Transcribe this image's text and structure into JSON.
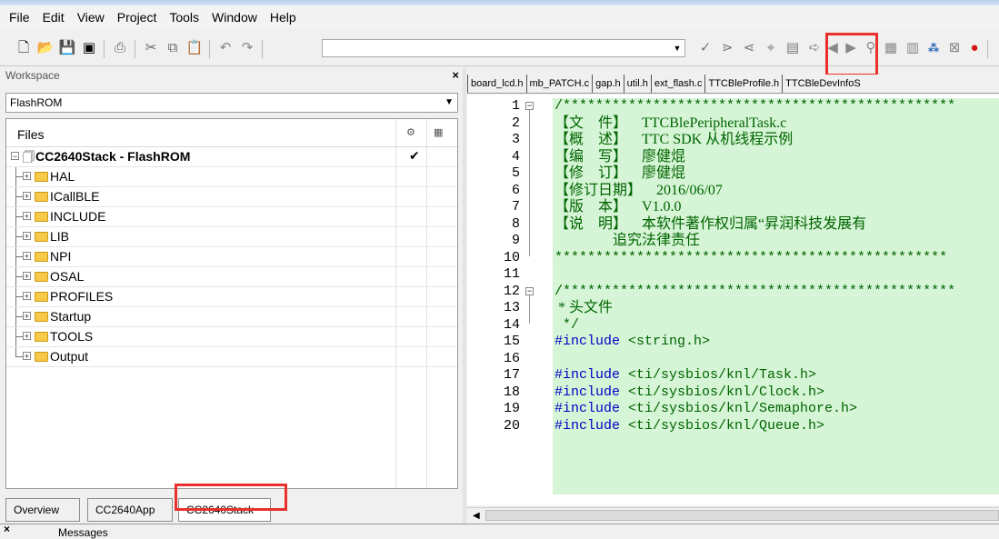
{
  "menu": [
    "File",
    "Edit",
    "View",
    "Project",
    "Tools",
    "Window",
    "Help"
  ],
  "workspace": {
    "title": "Workspace",
    "close": "×",
    "config": "FlashROM",
    "files_header": "Files",
    "col1_icon": "settings-icon",
    "col2_icon": "options-icon",
    "project": "CC2640Stack - FlashROM",
    "project_check": "✔",
    "folders": [
      "HAL",
      "ICallBLE",
      "INCLUDE",
      "LIB",
      "NPI",
      "OSAL",
      "PROFILES",
      "Startup",
      "TOOLS",
      "Output"
    ],
    "tabs": [
      "Overview",
      "CC2640App",
      "CC2640Stack"
    ],
    "active_tab": "CC2640Stack"
  },
  "editor": {
    "tabs": [
      "board_lcd.h",
      "mb_PATCH.c",
      "gap.h",
      "util.h",
      "ext_flash.c",
      "TTCBleProfile.h",
      "TTCBleDevInfoS"
    ],
    "lines": [
      {
        "n": "1",
        "t": "/************************************************"
      },
      {
        "n": "2",
        "t": "【文    件】    TTCBlePeripheralTask.c"
      },
      {
        "n": "3",
        "t": "【概    述】    TTC SDK 从机线程示例"
      },
      {
        "n": "4",
        "t": "【编    写】    廖健焜"
      },
      {
        "n": "5",
        "t": "【修    订】    廖健焜"
      },
      {
        "n": "6",
        "t": "【修订日期】    2016/06/07"
      },
      {
        "n": "7",
        "t": "【版    本】    V1.0.0"
      },
      {
        "n": "8",
        "t": "【说    明】    本软件著作权归属“昇润科技发展有"
      },
      {
        "n": "9",
        "t": "                追究法律责任"
      },
      {
        "n": "10",
        "t": "************************************************"
      },
      {
        "n": "11",
        "t": ""
      },
      {
        "n": "12",
        "t": "/************************************************"
      },
      {
        "n": "13",
        "t": " * 头文件"
      },
      {
        "n": "14",
        "t": " */"
      },
      {
        "n": "15",
        "kw": "#include",
        "t": " <string.h>"
      },
      {
        "n": "16",
        "t": ""
      },
      {
        "n": "17",
        "kw": "#include",
        "t": " <ti/sysbios/knl/Task.h>"
      },
      {
        "n": "18",
        "kw": "#include",
        "t": " <ti/sysbios/knl/Clock.h>"
      },
      {
        "n": "19",
        "kw": "#include",
        "t": " <ti/sysbios/knl/Semaphore.h>"
      },
      {
        "n": "20",
        "kw": "#include",
        "t": " <ti/sysbios/knl/Queue.h>"
      }
    ]
  },
  "messages": {
    "label": "Messages",
    "close": "×"
  },
  "colors": {
    "highlight": "#e8302c",
    "comment_bg": "#d6f5d6",
    "comment": "#006400",
    "keyword": "#0000c8"
  }
}
